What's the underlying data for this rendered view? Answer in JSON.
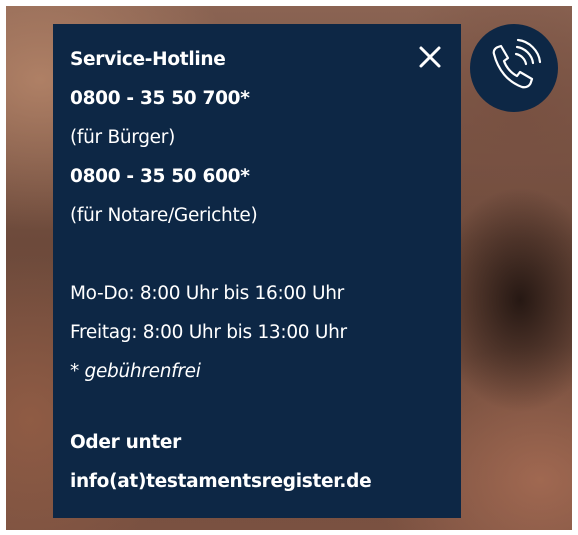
{
  "hotline_panel": {
    "title": "Service-Hotline",
    "phone_citizens": "0800 - 35 50 700*",
    "label_citizens": "(für Bürger)",
    "phone_notaries": "0800 - 35 50 600*",
    "label_notaries": "(für Notare/Gerichte)",
    "hours_mon_thu": "Mo-Do: 8:00 Uhr bis 16:00 Uhr",
    "hours_fri": "Freitag: 8:00 Uhr bis 13:00 Uhr",
    "toll_free_note": "* gebührenfrei",
    "contact_intro": "Oder unter",
    "email": "info(at)testamentsregister.de",
    "close_icon": "close-icon",
    "phone_icon": "phone-ringing-icon"
  },
  "colors": {
    "panel_background": "#0d2745",
    "text": "#ffffff"
  }
}
